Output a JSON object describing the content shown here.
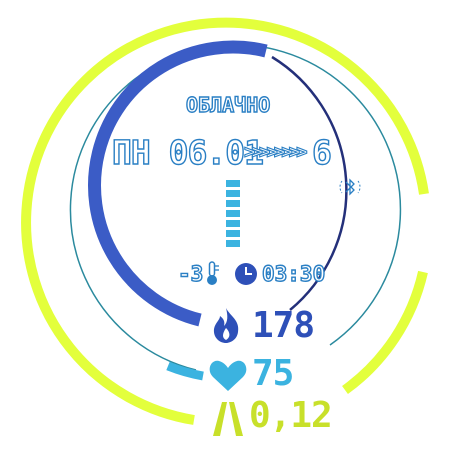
{
  "watch": {
    "weather_condition": "ОБЛАЧНО",
    "date": "ПН 06.01",
    "week_indicator": ">>>>>>>>",
    "week_number": "6",
    "temperature": "-3",
    "time": "03:30",
    "calories": "178",
    "heart_rate": "75",
    "distance": "0,12"
  },
  "colors": {
    "outer_ring": "#e3ff3c",
    "blue_arc": "#3b5cc6",
    "cyan": "#3bb3e0",
    "navy_thin": "#24307a",
    "teal_thin": "#2b8a9e"
  },
  "icons": {
    "weather": "cloud-icon",
    "temperature": "thermometer-icon",
    "time": "clock-icon",
    "calories": "flame-icon",
    "heart_rate": "heart-icon",
    "distance": "road-icon",
    "bluetooth": "bluetooth-icon"
  }
}
